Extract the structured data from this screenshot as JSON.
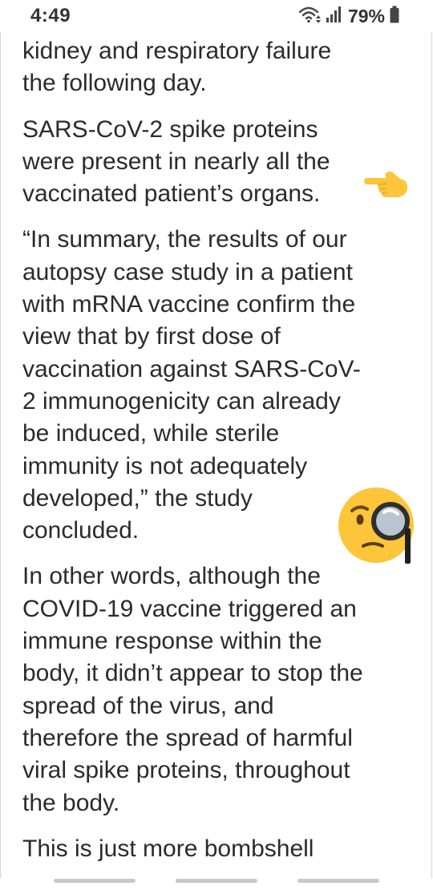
{
  "status_bar": {
    "time": "4:49",
    "battery_percent": "79%",
    "icons": [
      "wifi-icon",
      "signal-icon",
      "battery-icon"
    ]
  },
  "article": {
    "paragraphs": [
      "kidney and respiratory failure\nthe following day.",
      "SARS-CoV-2 spike proteins\nwere present in nearly all the\nvaccinated patient’s organs.",
      "“In summary, the results of our\nautopsy case study in a patient\nwith mRNA vaccine confirm the\nview that by first dose of\nvaccination against SARS-CoV-\n2 immunogenicity can already\nbe induced, while sterile\nimmunity is not adequately\ndeveloped,” the study\nconcluded.",
      "In other words, although the\nCOVID-19 vaccine triggered an\nimmune response within the\nbody, it didn’t appear to stop the\nspread of the virus, and\ntherefore the spread of harmful\nviral spike proteins, throughout\nthe body.",
      "This is just more bombshell"
    ]
  },
  "stickers": [
    "pointing-hand-left-emoji",
    "face-with-monocle-emoji"
  ],
  "colors": {
    "text": "#2b2b2b",
    "emoji_yellow": "#fcc53a",
    "frame_border": "#d6d6d6"
  }
}
